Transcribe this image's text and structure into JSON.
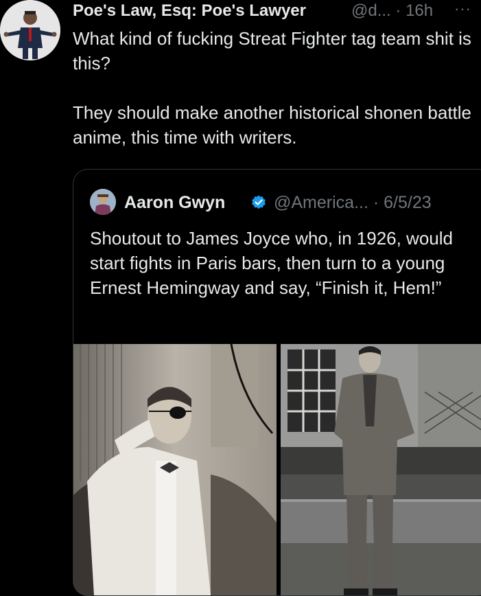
{
  "tweet": {
    "author_name": "Poe's Law, Esq: Poe's Lawyer",
    "author_handle": "@d...",
    "time_sep": "·",
    "time": "16h",
    "more": "···",
    "text": "What kind of fucking Streat Fighter tag team shit is this?\n\nThey should make another historical shonen battle anime, this time with writers."
  },
  "quote": {
    "author_name": "Aaron Gwyn",
    "author_handle": "@America...",
    "time_sep": "·",
    "date": "6/5/23",
    "text": "Shoutout to James Joyce who, in 1926, would start fights in Paris bars, then turn to a young Ernest Hemingway and say, “Finish it, Hem!”"
  },
  "colors": {
    "background": "#000000",
    "text": "#e7e9ea",
    "muted": "#71767b",
    "verified": "#1d9bf0",
    "border": "#2f3336"
  },
  "icons": [
    "more-icon",
    "verified-badge-icon"
  ]
}
